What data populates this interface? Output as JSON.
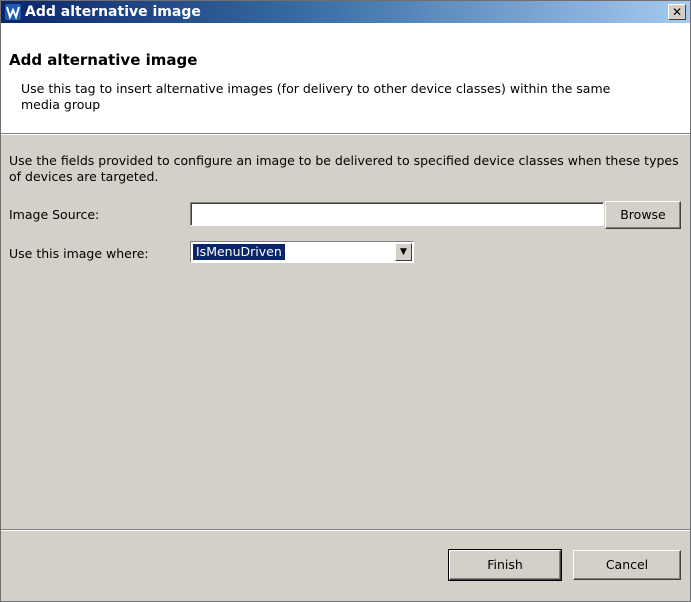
{
  "window": {
    "title": "Add alternative image",
    "close_glyph": "✕"
  },
  "banner": {
    "title": "Add alternative image",
    "description": "Use this tag to insert alternative images (for delivery to other device classes) within the same media group"
  },
  "form": {
    "intro": "Use the fields provided to configure an image to be delivered to specified device classes when these types of devices are targeted.",
    "image_source_label": "Image Source:",
    "image_source_value": "",
    "browse_label": "Browse",
    "use_where_label": "Use this image where:",
    "use_where_value": "IsMenuDriven"
  },
  "footer": {
    "finish_label": "Finish",
    "cancel_label": "Cancel"
  },
  "icons": {
    "app_icon": "app-logo-icon",
    "dropdown": "chevron-down-icon"
  }
}
